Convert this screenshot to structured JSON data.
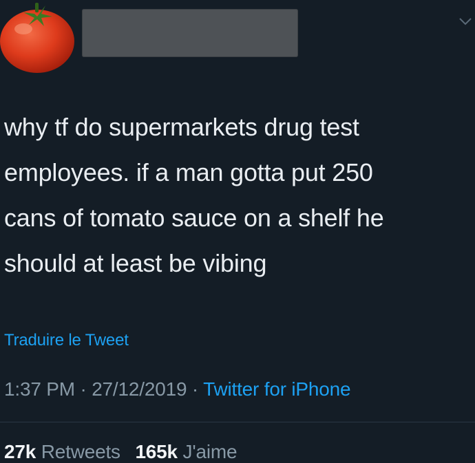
{
  "header": {
    "avatar_icon": "tomato-icon",
    "menu_icon": "chevron-down-icon"
  },
  "tweet": {
    "text_lines": [
      "why tf do supermarkets drug test",
      "employees. if a man gotta put 250",
      "cans of tomato sauce on a shelf he",
      "should at least be vibing"
    ],
    "translate_label": "Traduire le Tweet",
    "time": "1:37 PM",
    "separator": " · ",
    "date": "27/12/2019",
    "client": "Twitter for iPhone"
  },
  "stats": {
    "retweets_count": "27k",
    "retweets_label": "Retweets",
    "likes_count": "165k",
    "likes_label": "J'aime"
  },
  "colors": {
    "background": "#141d26",
    "text": "#e9edf1",
    "link": "#1da1f2",
    "secondary": "#8899a6",
    "redaction": "#4e5256"
  }
}
